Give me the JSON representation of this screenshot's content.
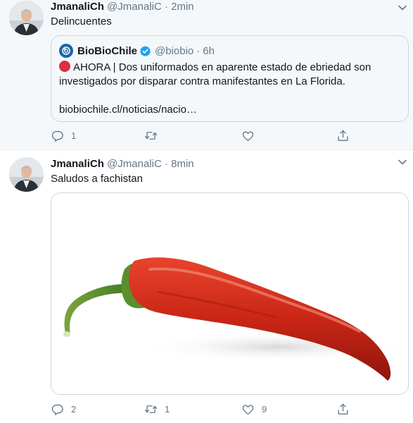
{
  "tweets": [
    {
      "author_name": "JmanaliCh",
      "handle": "@JmanaliC",
      "separator": "·",
      "time": "2min",
      "text": "Delincuentes",
      "quoted": {
        "author_name": "BioBioChile",
        "verified": true,
        "handle": "@biobio",
        "separator": "·",
        "time": "6h",
        "text": "AHORA | Dos uniformados en aparente estado de ebriedad son investigados por disparar contra manifestantes en La Florida.",
        "link": "biobiochile.cl/noticias/nacio…"
      },
      "actions": {
        "replies": "1",
        "retweets": "",
        "likes": ""
      }
    },
    {
      "author_name": "JmanaliCh",
      "handle": "@JmanaliC",
      "separator": "·",
      "time": "8min",
      "text": "Saludos a fachistan",
      "media": {
        "subject": "red chili pepper"
      },
      "actions": {
        "replies": "2",
        "retweets": "1",
        "likes": "9"
      }
    }
  ],
  "icons": {
    "reply": "reply-icon",
    "retweet": "retweet-icon",
    "like": "heart-icon",
    "share": "share-icon",
    "caret": "chevron-down-icon",
    "verified": "verified-badge-icon"
  },
  "colors": {
    "link_blue": "#1da1f2",
    "secondary_text": "#657786",
    "alert_red": "#dd2e44",
    "pepper_red": "#d8301e",
    "stem_green": "#4f8a2c"
  }
}
